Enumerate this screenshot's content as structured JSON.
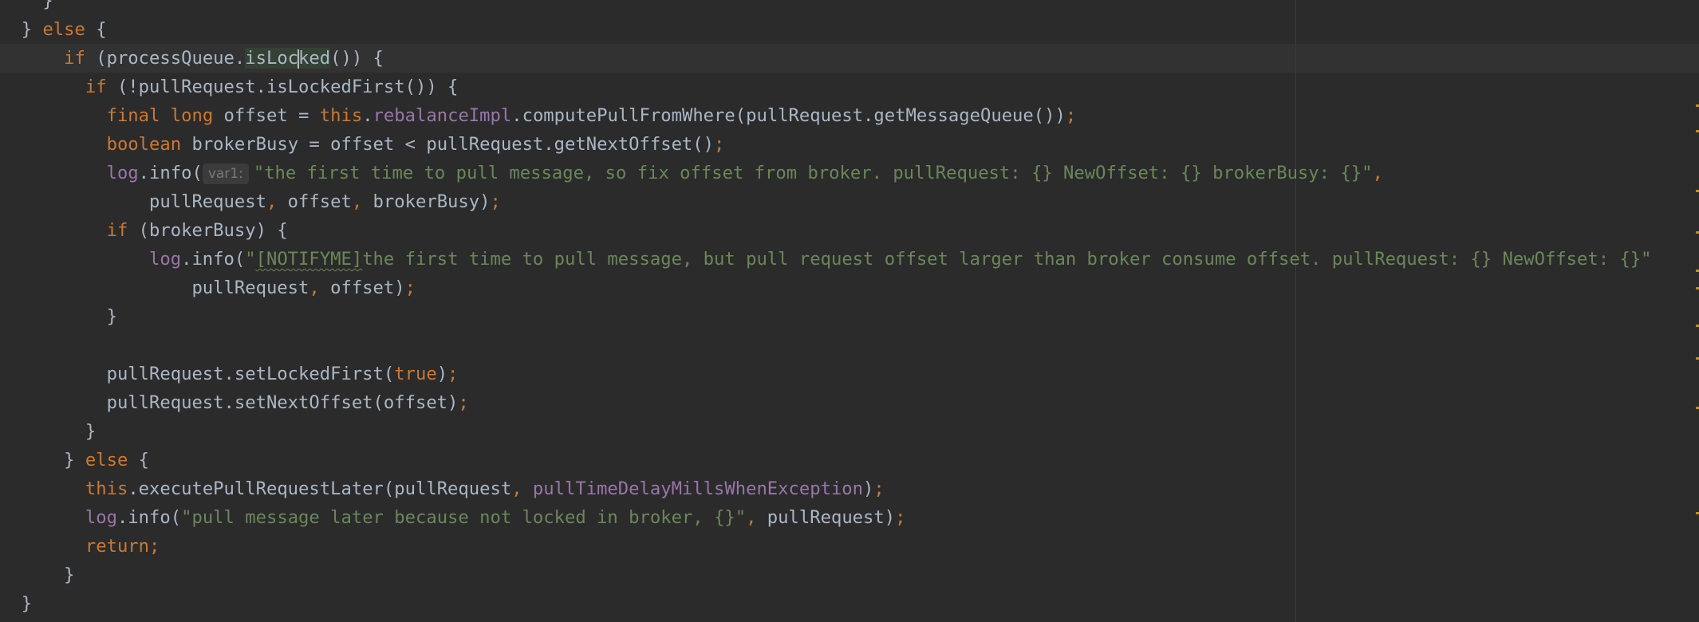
{
  "editor": {
    "lines": [
      {
        "pre": "    }"
      },
      {
        "pre": "  } ",
        "kw1": "else",
        "post": " {"
      },
      {
        "pre": "      ",
        "kw1": "if",
        "mid1": " (processQueue.",
        "hl_a": "isLoc",
        "hl_b": "ked",
        "post": "()) {"
      },
      {
        "pre": "        ",
        "kw1": "if",
        "post": " (!pullRequest.isLockedFirst()) {"
      },
      {
        "pre": "          ",
        "kw1": "final long",
        "mid1": " offset = ",
        "kw2": "this",
        "mid2": ".",
        "field": "rebalanceImpl",
        "mid3": ".computePullFromWhere(pullRequest.getMessageQueue())",
        "semi": ";"
      },
      {
        "pre": "          ",
        "kw1": "boolean",
        "post": " brokerBusy = offset < pullRequest.getNextOffset()",
        "semi": ";"
      },
      {
        "pre": "          ",
        "field": "log",
        "mid1": ".info(",
        "hint": "var1:",
        "str": "\"the first time to pull message, so fix offset from broker. pullRequest: {} NewOffset: {} brokerBusy: {}\"",
        "comma": ","
      },
      {
        "pre": "              pullRequest",
        "c1": ",",
        "mid1": " offset",
        "c2": ",",
        "post": " brokerBusy)",
        "semi": ";"
      },
      {
        "pre": "          ",
        "kw1": "if",
        "post": " (brokerBusy) {"
      },
      {
        "pre": "              ",
        "field": "log",
        "mid1": ".info(",
        "str_a": "\"",
        "str_b": "[NOTIFYME]",
        "str_c": "the first time to pull message, but pull request offset larger than broker consume offset. pullRequest: {} NewOffset: {}\""
      },
      {
        "pre": "                  pullRequest",
        "c1": ",",
        "post": " offset)",
        "semi": ";"
      },
      {
        "pre": "          }"
      },
      {
        "pre": ""
      },
      {
        "pre": "          pullRequest.setLockedFirst(",
        "kw1": "true",
        "post": ")",
        "semi": ";"
      },
      {
        "pre": "          pullRequest.setNextOffset(offset)",
        "semi": ";"
      },
      {
        "pre": "        }"
      },
      {
        "pre": "      } ",
        "kw1": "else",
        "post": " {"
      },
      {
        "pre": "        ",
        "kw1": "this",
        "mid1": ".executePullRequestLater(pullRequest",
        "c1": ",",
        "mid2": " ",
        "field": "pullTimeDelayMillsWhenException",
        "post": ")",
        "semi": ";"
      },
      {
        "pre": "        ",
        "field": "log",
        "mid1": ".info(",
        "str": "\"pull message later because not locked in broker, {}\"",
        "c1": ",",
        "post": " pullRequest)",
        "semi": ";"
      },
      {
        "pre": "        ",
        "kw1": "return",
        "semi": ";"
      },
      {
        "pre": "      }"
      },
      {
        "pre": "  }"
      }
    ]
  },
  "colors": {
    "background": "#2b2b2b",
    "keyword": "#cc7832",
    "field": "#9876aa",
    "string": "#6a8759",
    "plain": "#a9b7c6",
    "current_line": "#323232"
  }
}
